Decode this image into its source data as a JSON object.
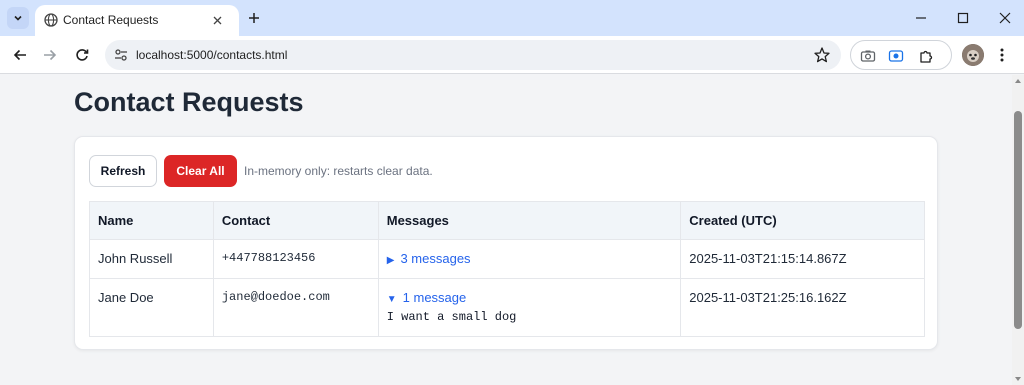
{
  "browser": {
    "tab_title": "Contact Requests",
    "url": "localhost:5000/contacts.html"
  },
  "page": {
    "title": "Contact Requests",
    "refresh_label": "Refresh",
    "clear_label": "Clear All",
    "hint": "In-memory only: restarts clear data."
  },
  "table": {
    "headers": [
      "Name",
      "Contact",
      "Messages",
      "Created (UTC)"
    ],
    "rows": [
      {
        "name": "John Russell",
        "contact": "+447788123456",
        "messages_label": "3 messages",
        "expanded": false,
        "created": "2025-11-03T21:15:14.867Z"
      },
      {
        "name": "Jane Doe",
        "contact": "jane@doedoe.com",
        "messages_label": "1 message",
        "expanded": true,
        "message_text": "I want a small dog",
        "created": "2025-11-03T21:25:16.162Z"
      }
    ]
  },
  "colors": {
    "danger": "#dc2626",
    "link": "#2563eb",
    "tabbar": "#d3e3fd"
  }
}
